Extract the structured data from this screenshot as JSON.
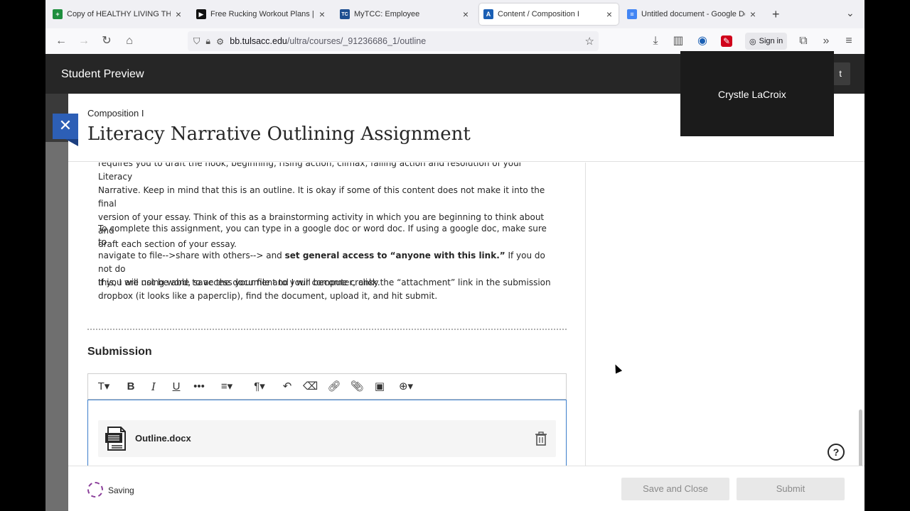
{
  "browser": {
    "tabs": [
      {
        "title": "Copy of HEALTHY LIVING THRE",
        "favicon_color": "#1e8e3e",
        "favicon_char": "+"
      },
      {
        "title": "Free Rucking Workout Plans | Bo",
        "favicon_color": "#111111",
        "favicon_char": "▶"
      },
      {
        "title": "MyTCC: Employee",
        "favicon_color": "#1d4f91",
        "favicon_char": "TC"
      },
      {
        "title": "Content / Composition I",
        "favicon_color": "#1a5fb4",
        "favicon_char": "A"
      },
      {
        "title": "Untitled document - Google Doc",
        "favicon_color": "#4285f4",
        "favicon_char": "≡"
      }
    ],
    "url_host": "bb.tulsacc.edu",
    "url_path": "/ultra/courses/_91236686_1/outline",
    "sign_in_label": "Sign in"
  },
  "page": {
    "preview_label": "Student Preview",
    "preview_exit_label": "t",
    "course_name": "Composition I",
    "assignment_title": "Literacy Narrative Outlining Assignment",
    "paragraphs": {
      "p1_cut": "requires you to draft the hook, beginning, rising action, climax, falling action and resolution of your Literacy",
      "p1_l2": "Narrative. Keep in mind that this is an outline. It is okay if some of this content does not make it into the final",
      "p1_l3": "version of your essay. Think of this as a brainstorming activity in which you are beginning to think about and",
      "p1_l4": "draft each section of your essay.",
      "p2_l1": "To complete this assignment, you can type in a google doc or word doc. If using a google doc, make sure to",
      "p2_l2a": "navigate to file-->share with others--> and ",
      "p2_l2b": "set general access to “anyone with this link.”",
      "p2_l2c": " If you do not do",
      "p2_l3": "this, I will not be able to access your file and I will become cranky.",
      "p3_l1": "If you are using word, save the document to your computer, click the “attachment” link in the submission",
      "p3_l2": "dropbox (it looks like a paperclip), find the document, upload it, and hit submit."
    },
    "submission_label": "Submission",
    "attachment_name": "Outline.docx",
    "saving_label": "Saving",
    "save_close_label": "Save and Close",
    "submit_label": "Submit",
    "video_participant": "Crystle LaCroix",
    "help_label": "?"
  }
}
